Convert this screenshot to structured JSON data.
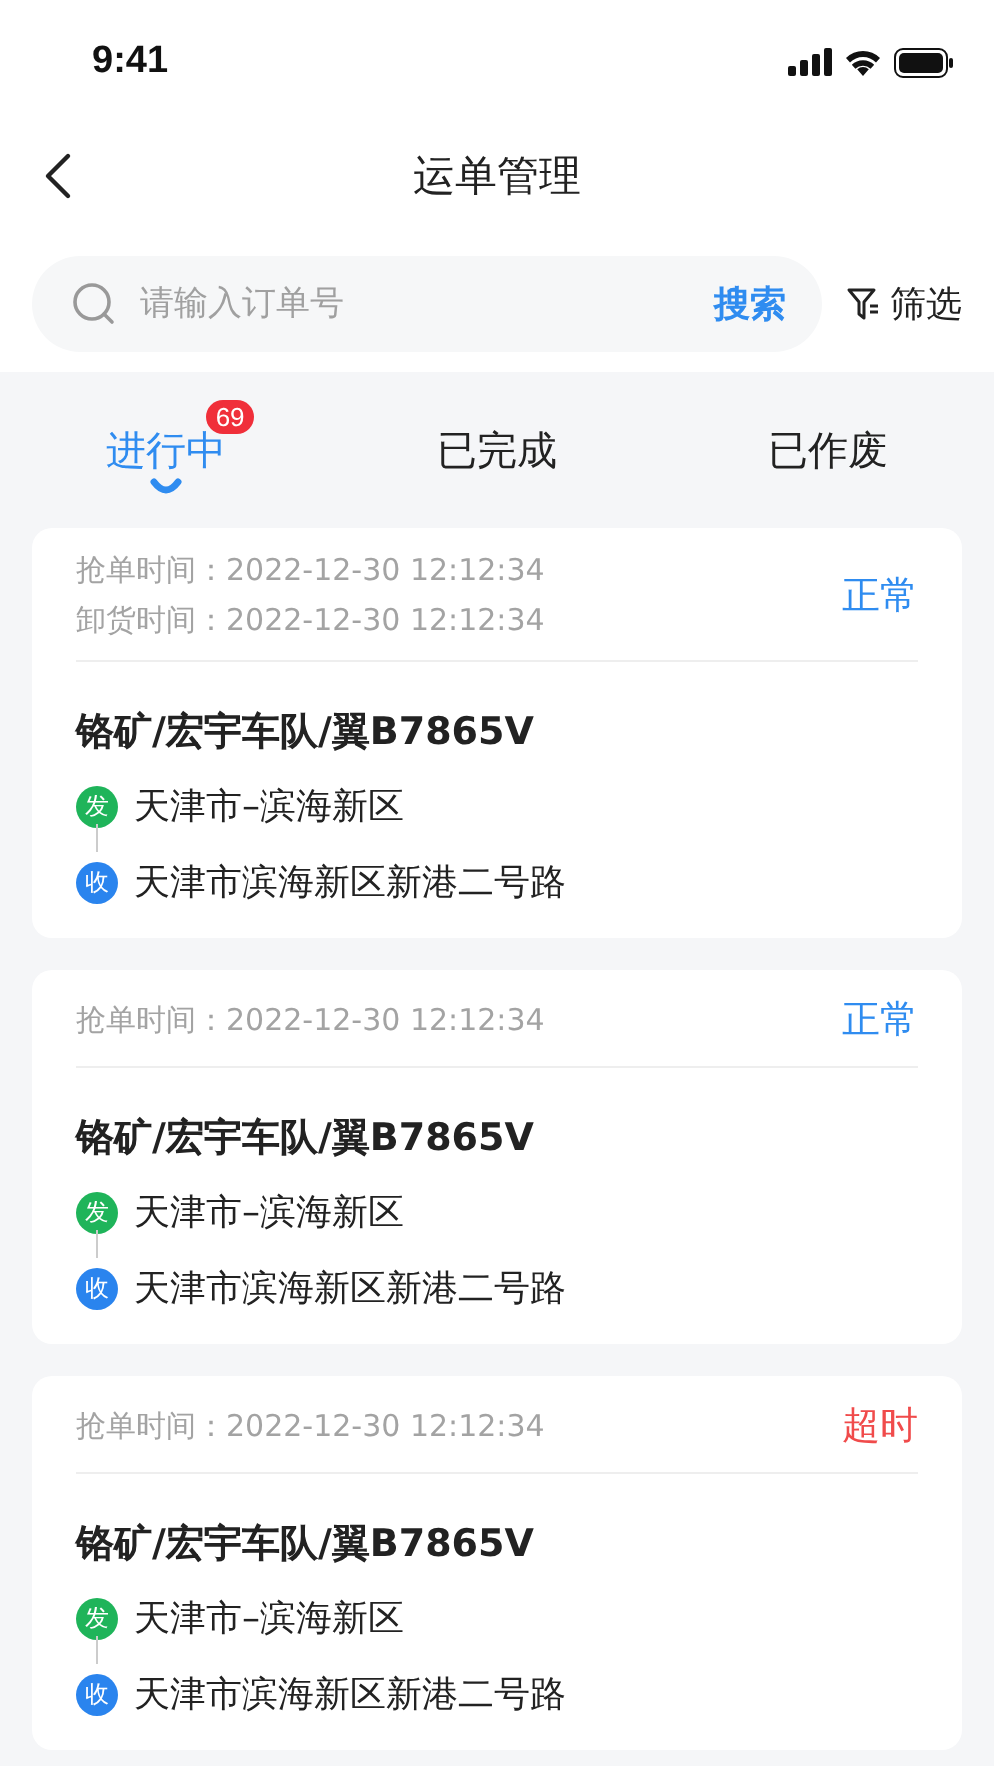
{
  "status_bar": {
    "time": "9:41"
  },
  "header": {
    "title": "运单管理"
  },
  "search": {
    "placeholder": "请输入订单号",
    "button": "搜索",
    "filter": "筛选"
  },
  "tabs": [
    {
      "label": "进行中",
      "selected": true,
      "badge": "69"
    },
    {
      "label": "已完成",
      "selected": false
    },
    {
      "label": "已作废",
      "selected": false
    }
  ],
  "orders": [
    {
      "times": [
        {
          "label": "抢单时间：",
          "value": "2022-12-30 12:12:34"
        },
        {
          "label": "卸货时间：",
          "value": "2022-12-30 12:12:34"
        }
      ],
      "status": {
        "kind": "normal",
        "text": "正常"
      },
      "title": "铬矿/宏宇车队/翼B7865V",
      "stops": [
        {
          "kind": "from",
          "mark": "发",
          "text": "天津市–滨海新区"
        },
        {
          "kind": "to",
          "mark": "收",
          "text": "天津市滨海新区新港二号路"
        }
      ]
    },
    {
      "times": [
        {
          "label": "抢单时间：",
          "value": "2022-12-30 12:12:34"
        }
      ],
      "status": {
        "kind": "normal",
        "text": "正常"
      },
      "title": "铬矿/宏宇车队/翼B7865V",
      "stops": [
        {
          "kind": "from",
          "mark": "发",
          "text": "天津市–滨海新区"
        },
        {
          "kind": "to",
          "mark": "收",
          "text": "天津市滨海新区新港二号路"
        }
      ]
    },
    {
      "times": [
        {
          "label": "抢单时间：",
          "value": "2022-12-30 12:12:34"
        }
      ],
      "status": {
        "kind": "overtime",
        "text": "超时"
      },
      "title": "铬矿/宏宇车队/翼B7865V",
      "stops": [
        {
          "kind": "from",
          "mark": "发",
          "text": "天津市–滨海新区"
        },
        {
          "kind": "to",
          "mark": "收",
          "text": "天津市滨海新区新港二号路"
        }
      ]
    }
  ]
}
